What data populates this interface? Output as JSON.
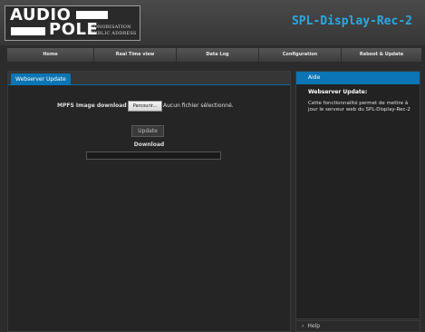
{
  "brand": {
    "logo_line1": "AUDIO",
    "logo_line2": "POLE",
    "tagline_line1": "SONORISATION",
    "tagline_line2": "PUBLIC ADDRESS"
  },
  "app_title": "SPL-Display-Rec-2",
  "nav": {
    "items": [
      {
        "label": "Home"
      },
      {
        "label": "Real Time view"
      },
      {
        "label": "Data Log"
      },
      {
        "label": "Configuration"
      },
      {
        "label": "Reboot & Update"
      }
    ]
  },
  "panel": {
    "tab_label": "Webserver Update",
    "mpfs_label": "MPFS Image download",
    "browse_label": "Parcourir...",
    "file_status": "Aucun fichier sélectionné.",
    "update_label": "Update",
    "download_label": "Download",
    "download_progress": 0
  },
  "aide": {
    "header": "Aide",
    "title": "Webserver Update:",
    "text": "Cette fonctionnalité permet de mettre à jour le serveur web du SPL-Display-Rec-2"
  },
  "help": {
    "icon": "chevron-right-icon",
    "label": "Help"
  },
  "colors": {
    "accent": "#0b75b5",
    "title": "#2aa9e0",
    "background": "#2c2c2c"
  }
}
